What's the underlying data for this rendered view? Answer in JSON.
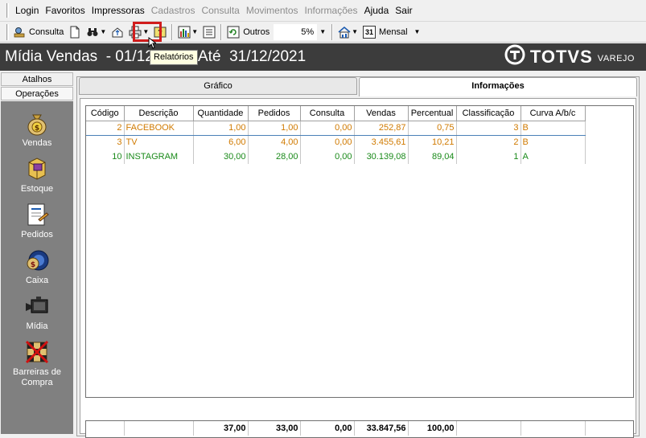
{
  "menu": [
    {
      "label": "Login",
      "disabled": false
    },
    {
      "label": "Favoritos",
      "disabled": false
    },
    {
      "label": "Impressoras",
      "disabled": false
    },
    {
      "label": "Cadastros",
      "disabled": true
    },
    {
      "label": "Consulta",
      "disabled": true
    },
    {
      "label": "Movimentos",
      "disabled": true
    },
    {
      "label": "Informações",
      "disabled": true
    },
    {
      "label": "Ajuda",
      "disabled": false
    },
    {
      "label": "Sair",
      "disabled": false
    }
  ],
  "toolbar": {
    "consulta_label": "Consulta",
    "outros_label": "Outros",
    "percent_value": "5%",
    "mensal_label": "Mensal",
    "calendar_number": "31",
    "highlight_color": "#d01c1c"
  },
  "tooltip": "Relatórios",
  "title": {
    "text": "Mídia Vendas  - 01/12",
    "text_after": "Até  31/12/2021",
    "logo_text": "TOTVS",
    "logo_sub": "VAREJO"
  },
  "sidebar": {
    "tabs": [
      "Atalhos",
      "Operações"
    ],
    "items": [
      {
        "label": "Vendas",
        "icon": "money-bag-icon"
      },
      {
        "label": "Estoque",
        "icon": "boxes-icon"
      },
      {
        "label": "Pedidos",
        "icon": "order-document-icon"
      },
      {
        "label": "Caixa",
        "icon": "cash-register-icon"
      },
      {
        "label": "Mídia",
        "icon": "media-icon"
      },
      {
        "label": "Barreiras de Compra",
        "icon": "purchase-barrier-icon"
      }
    ]
  },
  "tabs": [
    {
      "label": "Gráfico",
      "active": false
    },
    {
      "label": "Informações",
      "active": true
    }
  ],
  "grid": {
    "columns": [
      "Código",
      "Descrição",
      "Quantidade",
      "Pedidos",
      "Consulta",
      "Vendas",
      "Percentual",
      "Classificação",
      "Curva A/b/c"
    ],
    "rows": [
      {
        "codigo": "2",
        "descricao": "FACEBOOK",
        "quantidade": "1,00",
        "pedidos": "1,00",
        "consulta": "0,00",
        "vendas": "252,87",
        "percentual": "0,75",
        "classificacao": "3",
        "curva": "B",
        "color": "orange"
      },
      {
        "codigo": "3",
        "descricao": "TV",
        "quantidade": "6,00",
        "pedidos": "4,00",
        "consulta": "0,00",
        "vendas": "3.455,61",
        "percentual": "10,21",
        "classificacao": "2",
        "curva": "B",
        "color": "orange"
      },
      {
        "codigo": "10",
        "descricao": "INSTAGRAM",
        "quantidade": "30,00",
        "pedidos": "28,00",
        "consulta": "0,00",
        "vendas": "30.139,08",
        "percentual": "89,04",
        "classificacao": "1",
        "curva": "A",
        "color": "green"
      }
    ],
    "totals": {
      "quantidade": "37,00",
      "pedidos": "33,00",
      "consulta": "0,00",
      "vendas": "33.847,56",
      "percentual": "100,00"
    }
  },
  "colors": {
    "title_bar": "#3c3c3c",
    "sidebar_bg": "#808080",
    "row_orange": "#d07a00",
    "row_green": "#1a8a1a"
  }
}
